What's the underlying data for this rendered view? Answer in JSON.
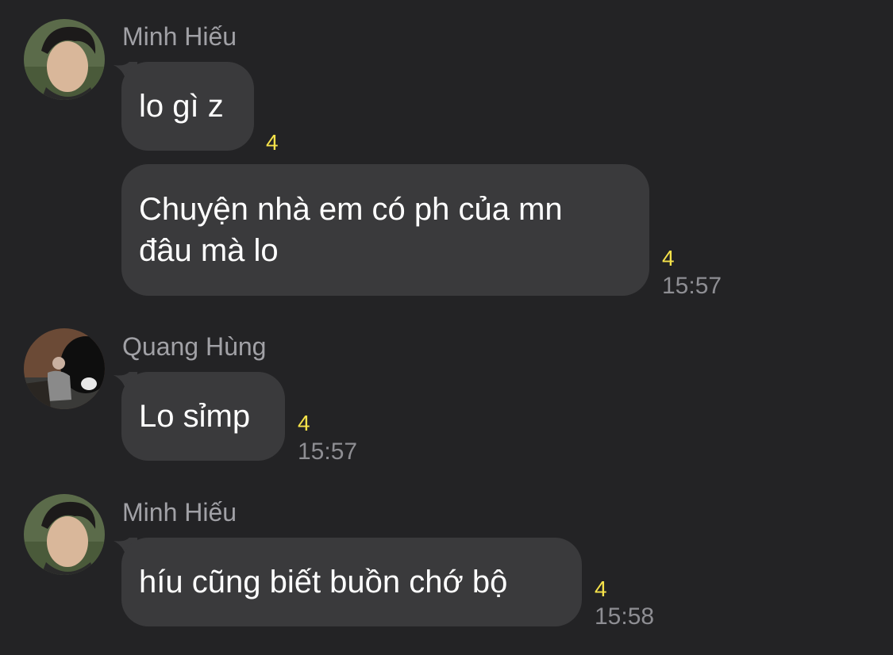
{
  "colors": {
    "background": "#232325",
    "bubble": "#3a3a3c",
    "sender_name": "#a1a1a6",
    "message_text": "#ffffff",
    "read_badge": "#f6e24a",
    "timestamp": "#8e8e93"
  },
  "messages": [
    {
      "sender": "Minh Hiếu",
      "text": "lo gì z",
      "read_count": "4",
      "time": ""
    },
    {
      "sender": "",
      "text": "Chuyện nhà em có ph của mn\nđâu mà lo",
      "read_count": "4",
      "time": "15:57"
    },
    {
      "sender": "Quang Hùng",
      "text": "Lo sỉmp",
      "read_count": "4",
      "time": "15:57"
    },
    {
      "sender": "Minh Hiếu",
      "text": "híu cũng biết buồn chớ bộ",
      "read_count": "4",
      "time": "15:58"
    }
  ]
}
